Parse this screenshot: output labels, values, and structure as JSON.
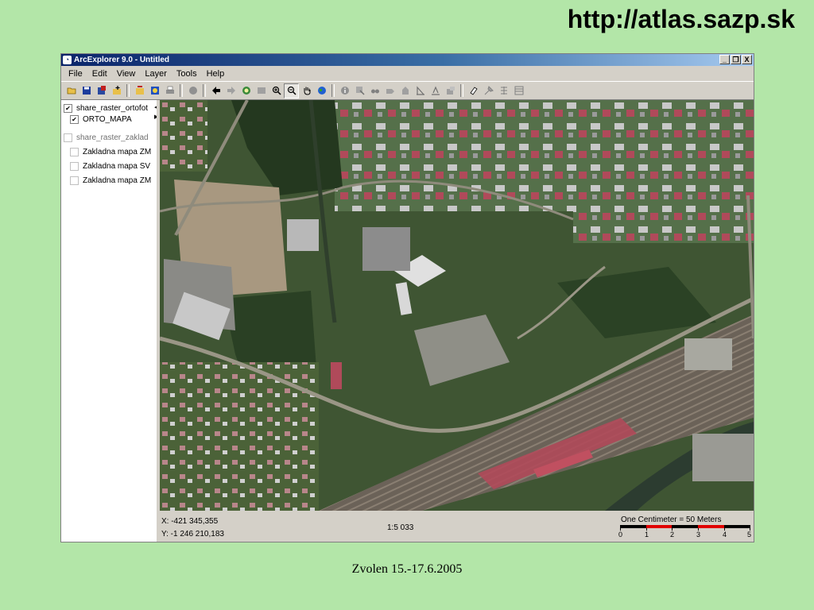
{
  "slide": {
    "url": "http://atlas.sazp.sk",
    "caption": "Zvolen 15.-17.6.2005"
  },
  "window": {
    "title": "ArcExplorer 9.0 - Untitled",
    "controls": [
      "_",
      "❐",
      "X"
    ]
  },
  "menu": [
    "File",
    "Edit",
    "View",
    "Layer",
    "Tools",
    "Help"
  ],
  "toolbar": {
    "icons": [
      "open-icon",
      "save-icon",
      "save-project-icon",
      "add-layer-icon",
      "add-data-icon",
      "map-properties-icon",
      "print-icon",
      "stop-icon",
      "back-extent-icon",
      "forward-extent-icon",
      "full-extent-icon",
      "layer-extent-icon",
      "zoom-in-icon",
      "zoom-out-icon",
      "pan-icon",
      "globe-icon",
      "identify-icon",
      "select-icon",
      "find-icon",
      "route-icon",
      "measure-icon",
      "hotlink-icon",
      "query-icon",
      "buffer-icon",
      "clear-icon",
      "eraser-icon",
      "tool2-icon",
      "tool3-icon",
      "tool4-icon"
    ],
    "active_tool": "zoom-out-icon"
  },
  "toc": [
    {
      "label": "share_raster_ortofot",
      "level": "group",
      "checked": true,
      "enabled": true
    },
    {
      "label": "ORTO_MAPA",
      "level": "child",
      "checked": true,
      "enabled": true
    },
    {
      "label": "share_raster_zaklad",
      "level": "group",
      "checked": false,
      "enabled": false
    },
    {
      "label": "Zakladna mapa ZM",
      "level": "child",
      "checked": false,
      "enabled": false
    },
    {
      "label": "Zakladna mapa SV",
      "level": "child",
      "checked": false,
      "enabled": false
    },
    {
      "label": "Zakladna mapa ZM",
      "level": "child",
      "checked": false,
      "enabled": false
    }
  ],
  "status": {
    "x": "X: -421 345,355",
    "y": "Y: -1 246 210,183",
    "scale": "1:5 033",
    "scalebar_title": "One Centimeter = 50 Meters",
    "scalebar_labels": [
      "0",
      "1",
      "2",
      "3",
      "4",
      "5"
    ]
  },
  "colors": {
    "background": "#b3e6a8",
    "title_bar": "#0a246a",
    "scalebar_red": "#e00000"
  }
}
